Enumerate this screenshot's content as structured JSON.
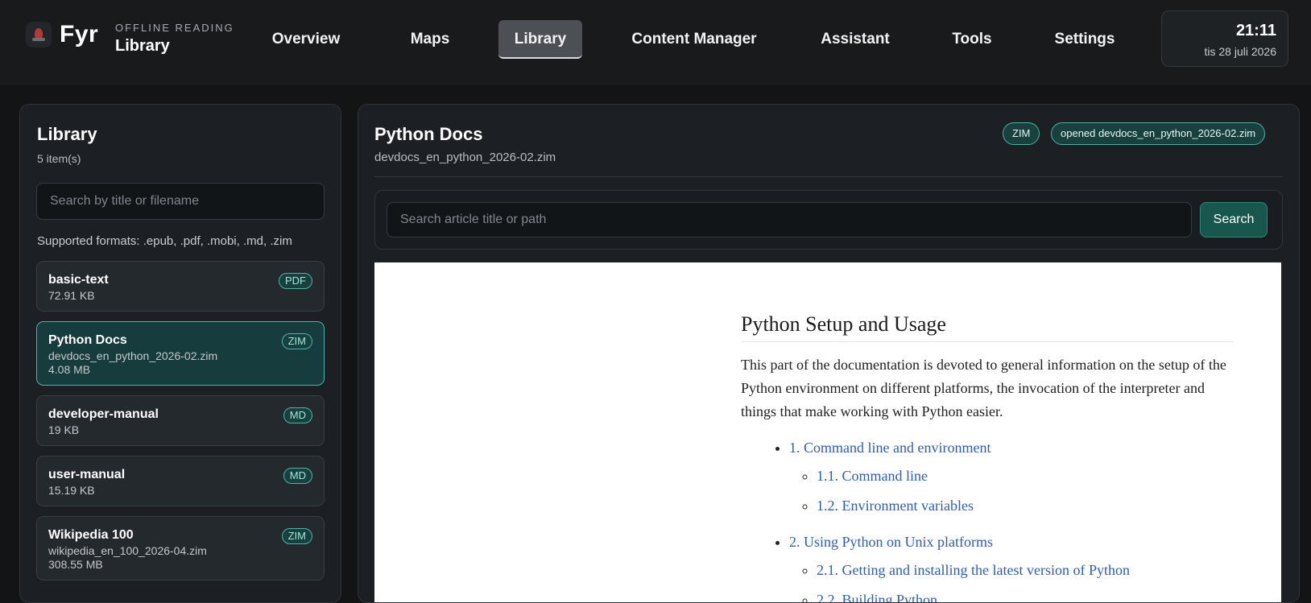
{
  "app": {
    "name": "Fyr",
    "kicker": "OFFLINE READING",
    "section": "Library"
  },
  "nav": [
    {
      "label": "Overview",
      "active": false
    },
    {
      "label": "Maps",
      "active": false
    },
    {
      "label": "Library",
      "active": true
    },
    {
      "label": "Content Manager",
      "active": false
    },
    {
      "label": "Assistant",
      "active": false
    },
    {
      "label": "Tools",
      "active": false
    },
    {
      "label": "Settings",
      "active": false
    }
  ],
  "clock": {
    "time": "21:11",
    "date": "tis 28 juli 2026"
  },
  "library": {
    "title": "Library",
    "count": "5 item(s)",
    "search_placeholder": "Search by title or filename",
    "formats": "Supported formats: .epub, .pdf, .mobi, .md, .zim",
    "items": [
      {
        "title": "basic-text",
        "file": "",
        "size": "72.91 KB",
        "type": "PDF",
        "selected": false
      },
      {
        "title": "Python Docs",
        "file": "devdocs_en_python_2026-02.zim",
        "size": "4.08 MB",
        "type": "ZIM",
        "selected": true
      },
      {
        "title": "developer-manual",
        "file": "",
        "size": "19 KB",
        "type": "MD",
        "selected": false
      },
      {
        "title": "user-manual",
        "file": "",
        "size": "15.19 KB",
        "type": "MD",
        "selected": false
      },
      {
        "title": "Wikipedia 100",
        "file": "wikipedia_en_100_2026-04.zim",
        "size": "308.55 MB",
        "type": "ZIM",
        "selected": false
      }
    ]
  },
  "document": {
    "title": "Python Docs",
    "filename": "devdocs_en_python_2026-02.zim",
    "type_chip": "ZIM",
    "status_chip": "opened devdocs_en_python_2026-02.zim",
    "search_placeholder": "Search article title or path",
    "search_label": "Search"
  },
  "article": {
    "heading": "Python Setup and Usage",
    "intro": "This part of the documentation is devoted to general information on the setup of the Python environment on different platforms, the invocation of the interpreter and things that make working with Python easier.",
    "toc": [
      {
        "label": "1. Command line and environment",
        "children": [
          "1.1. Command line",
          "1.2. Environment variables"
        ]
      },
      {
        "label": "2. Using Python on Unix platforms",
        "children": [
          "2.1. Getting and installing the latest version of Python",
          "2.2. Building Python"
        ]
      }
    ]
  },
  "colors": {
    "accent": "#4fb2a6",
    "background": "#121416",
    "link": "#2f5db3"
  }
}
